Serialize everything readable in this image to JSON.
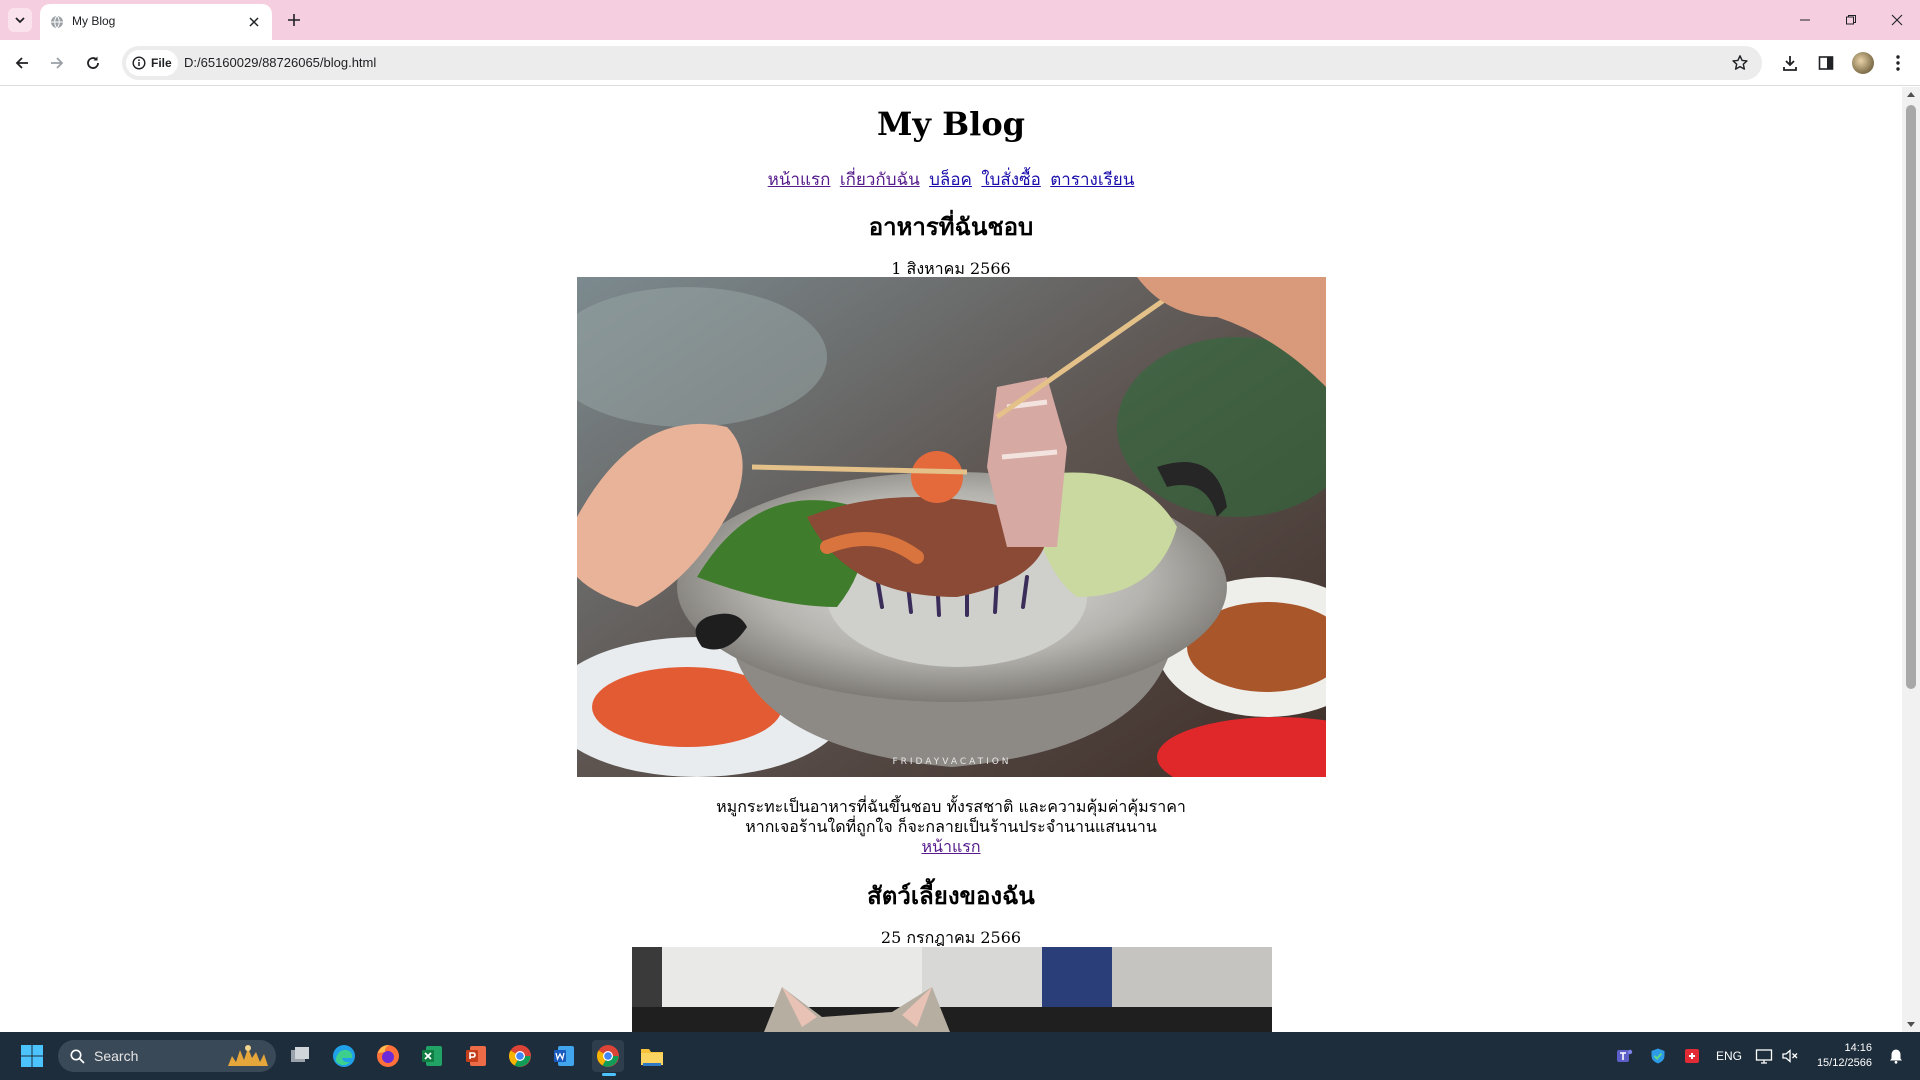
{
  "browser": {
    "tab_title": "My Blog",
    "omnibox_chip": "File",
    "url": "D:/65160029/88726065/blog.html"
  },
  "page": {
    "title": "My Blog",
    "nav": [
      {
        "label": "หน้าแรก",
        "visited": true
      },
      {
        "label": "เกี่ยวกับฉัน",
        "visited": true
      },
      {
        "label": "บล็อค",
        "visited": false
      },
      {
        "label": "ใบสั่งซื้อ",
        "visited": false
      },
      {
        "label": "ตารางเรียน",
        "visited": false
      }
    ],
    "posts": [
      {
        "title": "อาหารที่ฉันชอบ",
        "date": "1 สิงหาคม 2566",
        "image_watermark": "FRIDAYVACATION",
        "body_line1": "หมูกระทะเป็นอาหารที่ฉันขึ้นชอบ ทั้งรสชาติ และความคุ้มค่าคุ้มราคา",
        "body_line2": "หากเจอร้านใดที่ถูกใจ ก็จะกลายเป็นร้านประจำนานแสนนาน",
        "home_link": "หน้าแรก"
      },
      {
        "title": "สัตว์เลี้ยงของฉัน",
        "date": "25 กรกฎาคม 2566"
      }
    ]
  },
  "taskbar": {
    "search_placeholder": "Search",
    "language": "ENG",
    "time": "14:16",
    "date": "15/12/2566"
  },
  "colors": {
    "tabstrip": "#f5cfe0",
    "link": "#1a0dab",
    "visited_link": "#551a8b",
    "taskbar": "#1d2d3b"
  }
}
